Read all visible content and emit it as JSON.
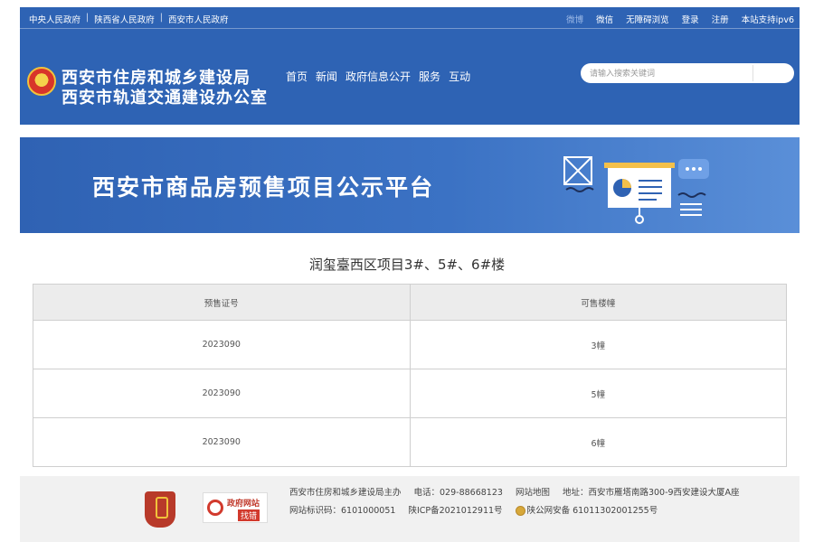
{
  "topbar": {
    "left_links": [
      "中央人民政府",
      "陕西省人民政府",
      "西安市人民政府"
    ],
    "right_links": [
      "微博",
      "微信",
      "无障碍浏览",
      "登录",
      "注册",
      "本站支持ipv6"
    ]
  },
  "header": {
    "org_name_1": "西安市住房和城乡建设局",
    "org_name_2": "西安市轨道交通建设办公室",
    "nav": [
      "首页",
      "新闻",
      "政府信息公开",
      "服务",
      "互动"
    ],
    "search_placeholder": "请输入搜索关键词"
  },
  "banner": {
    "title": "西安市商品房预售项目公示平台"
  },
  "project": {
    "title": "润玺臺西区项目3#、5#、6#楼"
  },
  "table": {
    "headers": [
      "预售证号",
      "可售楼幢"
    ],
    "rows": [
      [
        "2023090",
        "3幢"
      ],
      [
        "2023090",
        "5幢"
      ],
      [
        "2023090",
        "6幢"
      ]
    ]
  },
  "footer": {
    "host": "西安市住房和城乡建设局主办",
    "phone": "电话：029-88668123",
    "sitemap": "网站地图",
    "address": "地址：西安市雁塔南路300-9西安建设大厦A座",
    "site_code": "网站标识码：6101000051",
    "icp": "陕ICP备2021012911号",
    "police": "陕公网安备 61011302001255号",
    "badge2_title": "政府网站",
    "badge2_sub": "找错"
  },
  "colors": {
    "header_blue": "#2e63b4",
    "banner_blue": "#3b72c4",
    "table_header_bg": "#ececec",
    "footer_bg": "#f1f1f1"
  }
}
